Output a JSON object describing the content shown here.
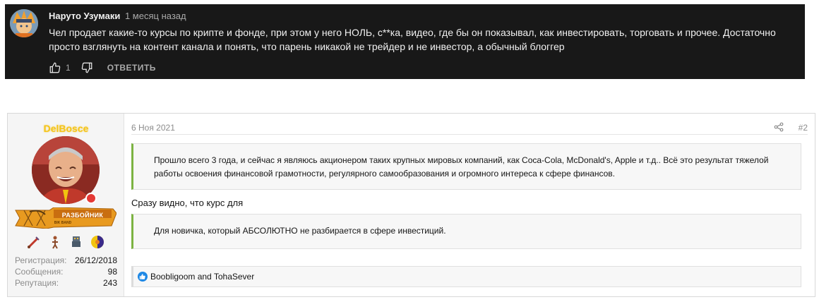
{
  "youtube_comment": {
    "author": "Наруто Узумаки",
    "time": "1 месяц назад",
    "text": "Чел продает какие-то курсы по крипте и фонде, при этом у него НОЛЬ, с**ка, видео, где бы он показывал, как инвестировать, торговать и прочее. Достаточно просто взглянуть на контент канала и понять, что парень никакой не трейдер и не инвестор, а обычный блоггер",
    "likes": "1",
    "reply_label": "ОТВЕТИТЬ",
    "icons": {
      "like": "thumbs-up-icon",
      "dislike": "thumbs-down-icon"
    },
    "colors": {
      "background": "#181818",
      "text": "#f1f1f1",
      "muted": "#aaaaaa"
    }
  },
  "forum_post": {
    "user": {
      "username": "DelBosce",
      "banner_title": "РАЗБОЙНИК",
      "banner_subtitle": "BIK BAND",
      "stats": [
        {
          "label": "Регистрация:",
          "value": "26/12/2018"
        },
        {
          "label": "Сообщения:",
          "value": "98"
        },
        {
          "label": "Репутация:",
          "value": "243"
        }
      ],
      "awards": [
        "sword-award-icon",
        "figure-award-icon",
        "robot-award-icon",
        "planet-award-icon"
      ]
    },
    "date": "6 Ноя 2021",
    "post_number": "#2",
    "quote1": "Прошло всего 3 года, и сейчас я являюсь акционером таких крупных мировых компаний, как Coca-Cola, McDonald's, Apple и т.д.. Всё это результат тяжелой работы освоения финансовой грамотности, регулярного самообразования и огромного интереса к сфере финансов.",
    "body": "Сразу видно, что курс для",
    "quote2": "Для новичка, который АБСОЛЮТНО не разбирается в сфере инвестиций.",
    "reactions": "Boobligoom and TohaSever",
    "colors": {
      "username": "#f5c518",
      "quote_accent": "#7cb342",
      "like": "#1e88e5"
    }
  }
}
